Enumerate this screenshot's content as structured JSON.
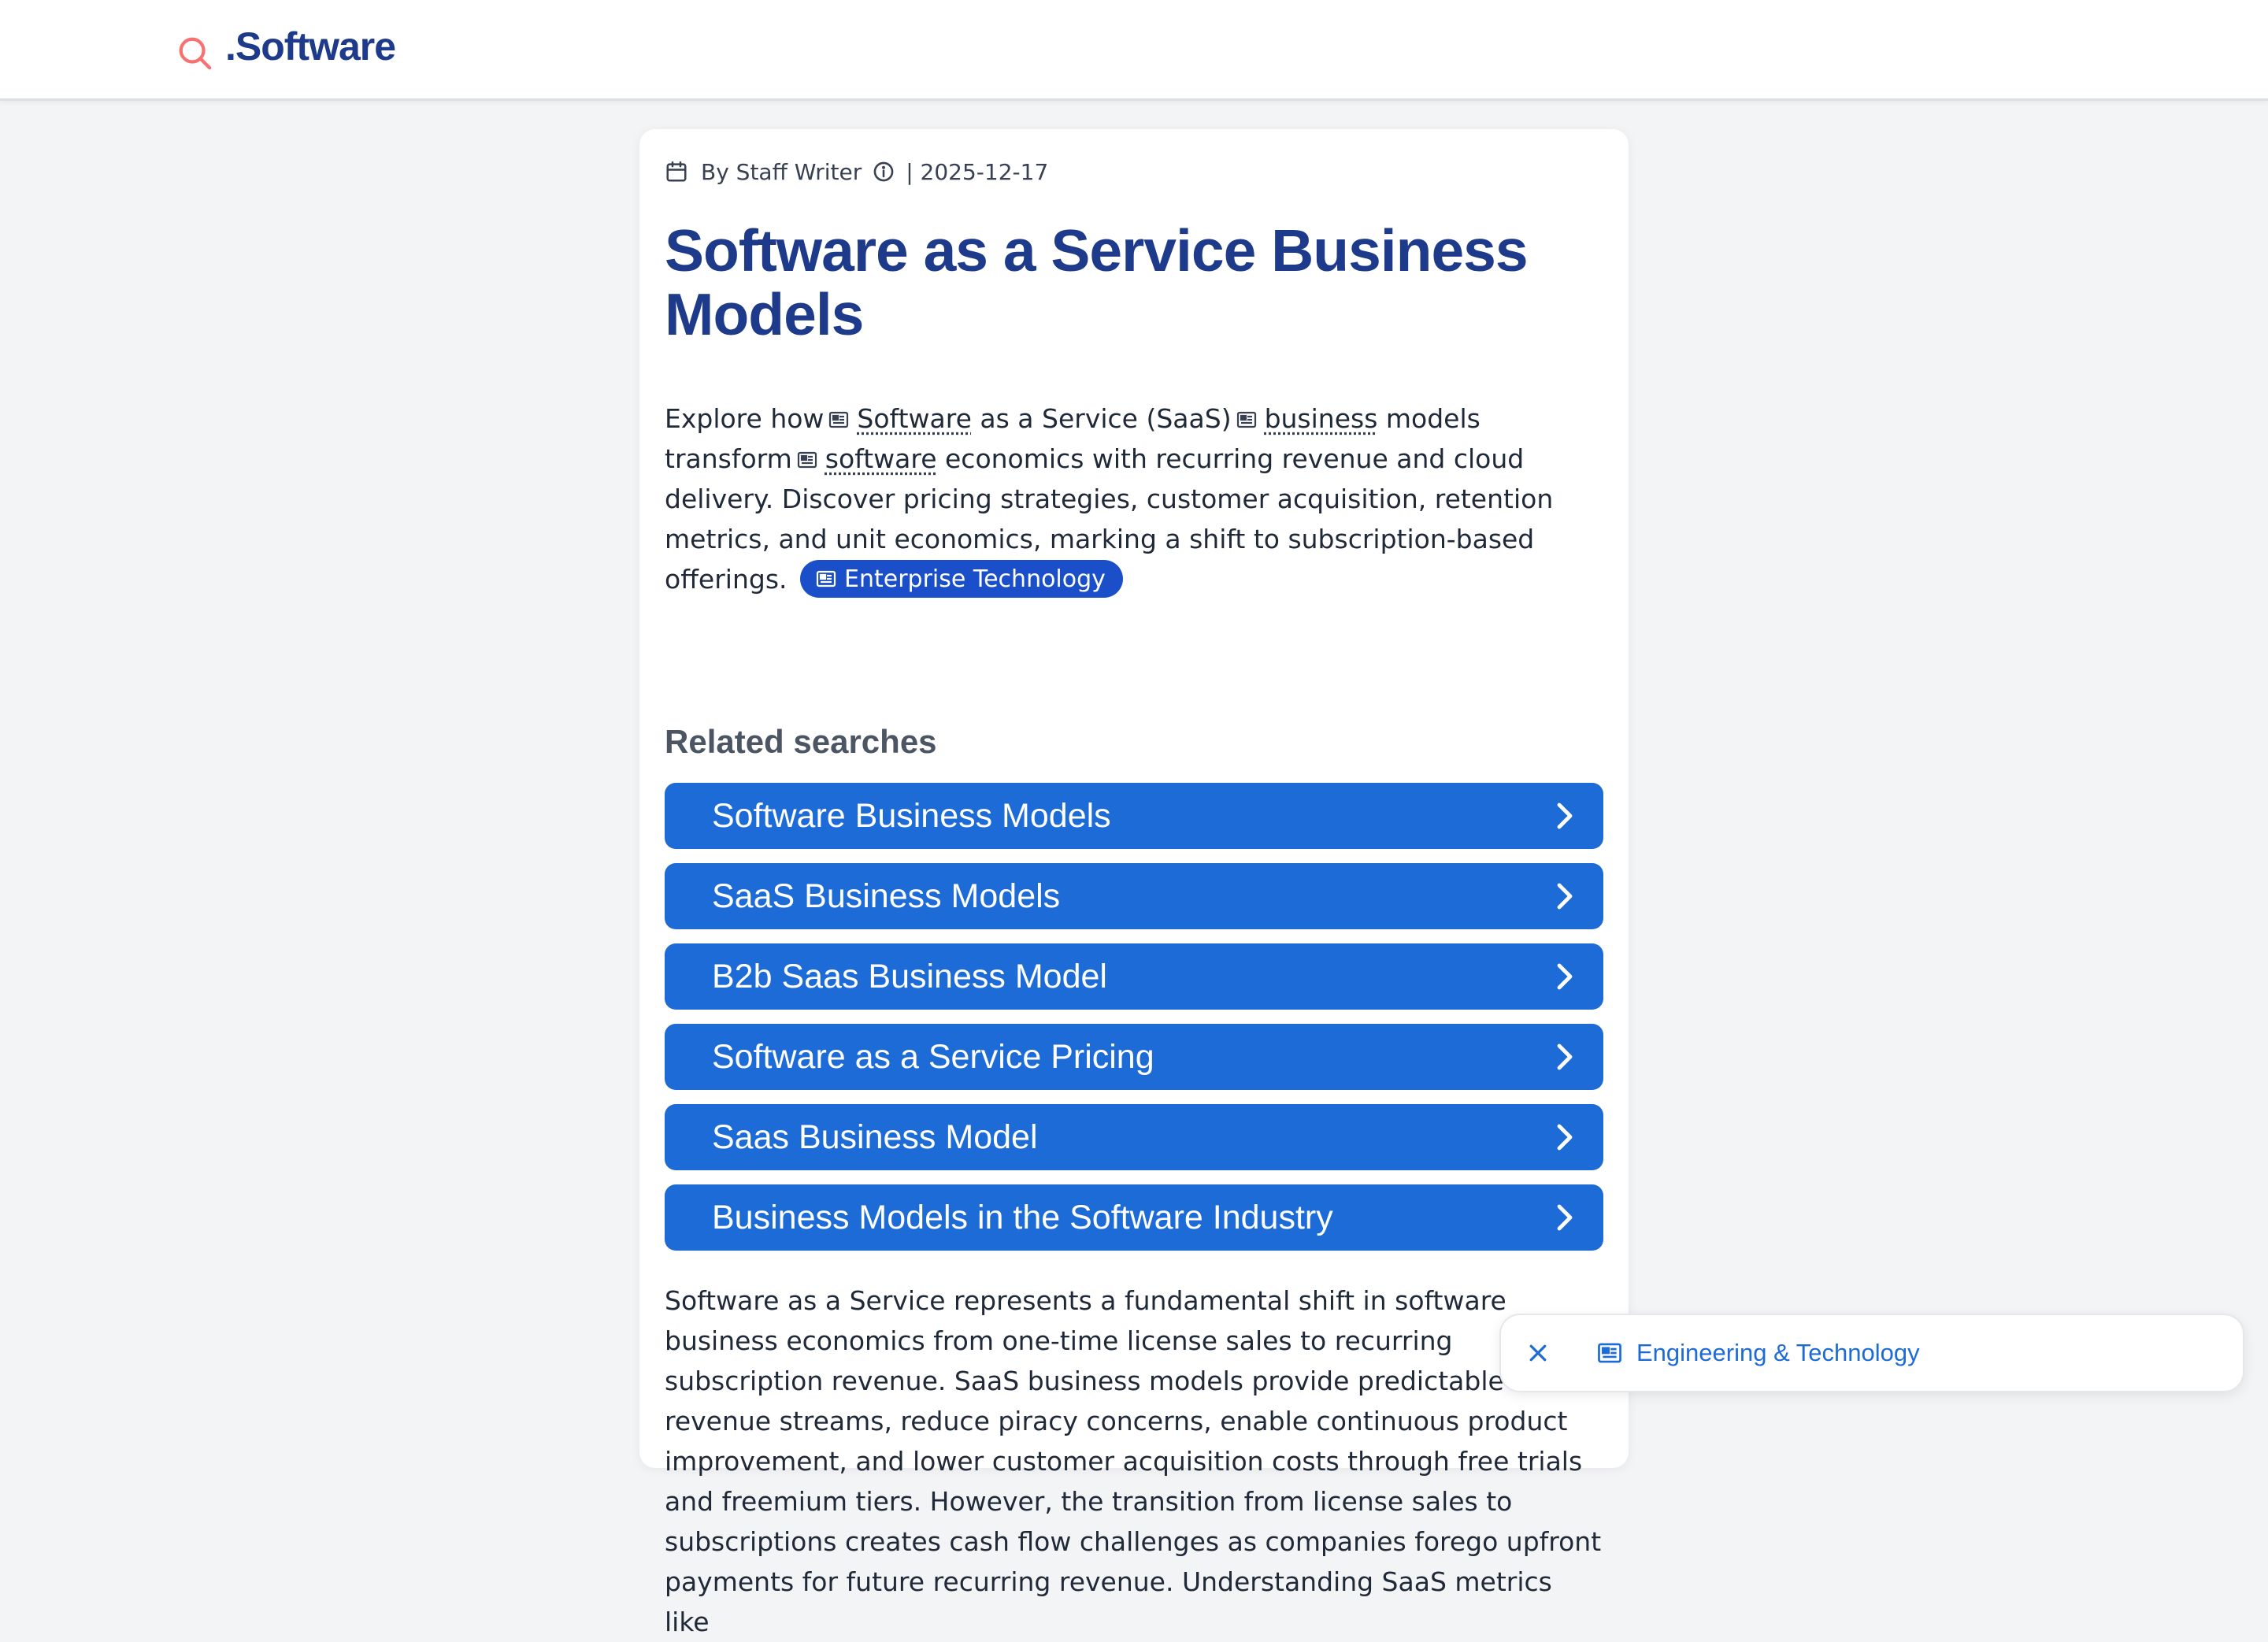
{
  "header": {
    "site_name": ".Software"
  },
  "article": {
    "byline": "By Staff Writer",
    "date": "| 2025-12-17",
    "title": "Software as a Service Business Models",
    "intro": {
      "t1": "Explore how",
      "kw1": "Software",
      "t2": "as a Service (SaaS)",
      "kw2": "business",
      "t3": "models transform",
      "kw3": "software",
      "t4": "economics with recurring revenue and cloud delivery. Discover pricing strategies, customer acquisition, retention metrics, and unit economics, marking a shift to subscription-based offerings.",
      "pill": "Enterprise Technology"
    },
    "body": "Software as a Service represents a fundamental shift in software business economics from one-time license sales to recurring subscription revenue. SaaS business models provide predictable revenue streams, reduce piracy concerns, enable continuous product improvement, and lower customer acquisition costs through free trials and freemium tiers. However, the transition from license sales to subscriptions creates cash flow challenges as companies forego upfront payments for future recurring revenue. Understanding SaaS metrics like"
  },
  "related": {
    "heading": "Related searches",
    "items": [
      "Software Business Models",
      "SaaS Business Models",
      "B2b Saas Business Model",
      "Software as a Service Pricing",
      "Saas Business Model",
      "Business Models in the Software Industry"
    ]
  },
  "toast": {
    "label": "Engineering & Technology"
  },
  "colors": {
    "brand": "#1e3a8a",
    "accent": "#1d6bd6",
    "logo_icon": "#f87171"
  },
  "icons": [
    "search-icon",
    "calendar-icon",
    "info-icon",
    "newspaper-icon",
    "chevron-right-icon",
    "close-icon"
  ]
}
